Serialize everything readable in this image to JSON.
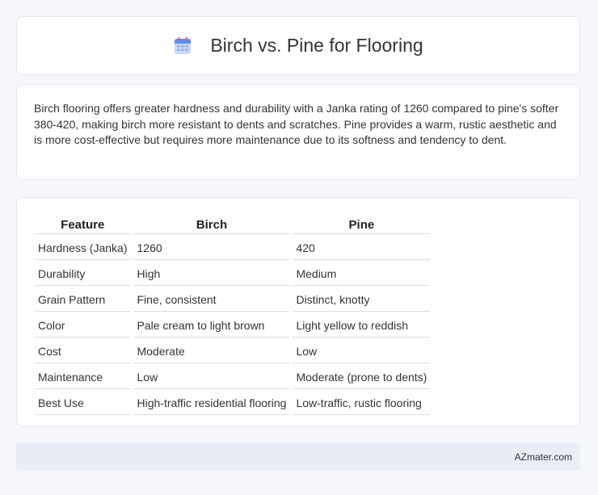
{
  "header": {
    "icon": "calendar-icon",
    "title": "Birch vs. Pine for Flooring"
  },
  "summary": {
    "text": "Birch flooring offers greater hardness and durability with a Janka rating of 1260 compared to pine's softer 380-420, making birch more resistant to dents and scratches. Pine provides a warm, rustic aesthetic and is more cost-effective but requires more maintenance due to its softness and tendency to dent."
  },
  "table": {
    "headers": [
      "Feature",
      "Birch",
      "Pine"
    ],
    "rows": [
      [
        "Hardness (Janka)",
        "1260",
        "420"
      ],
      [
        "Durability",
        "High",
        "Medium"
      ],
      [
        "Grain Pattern",
        "Fine, consistent",
        "Distinct, knotty"
      ],
      [
        "Color",
        "Pale cream to light brown",
        "Light yellow to reddish"
      ],
      [
        "Cost",
        "Moderate",
        "Low"
      ],
      [
        "Maintenance",
        "Low",
        "Moderate (prone to dents)"
      ],
      [
        "Best Use",
        "High-traffic residential flooring",
        "Low-traffic, rustic flooring"
      ]
    ]
  },
  "footer": {
    "text": "AZmater.com"
  },
  "colors": {
    "background": "#f5f7fa",
    "icon_blue": "#5b8def",
    "icon_pink": "#e86a7a",
    "footer_bg": "#e9eef6"
  }
}
